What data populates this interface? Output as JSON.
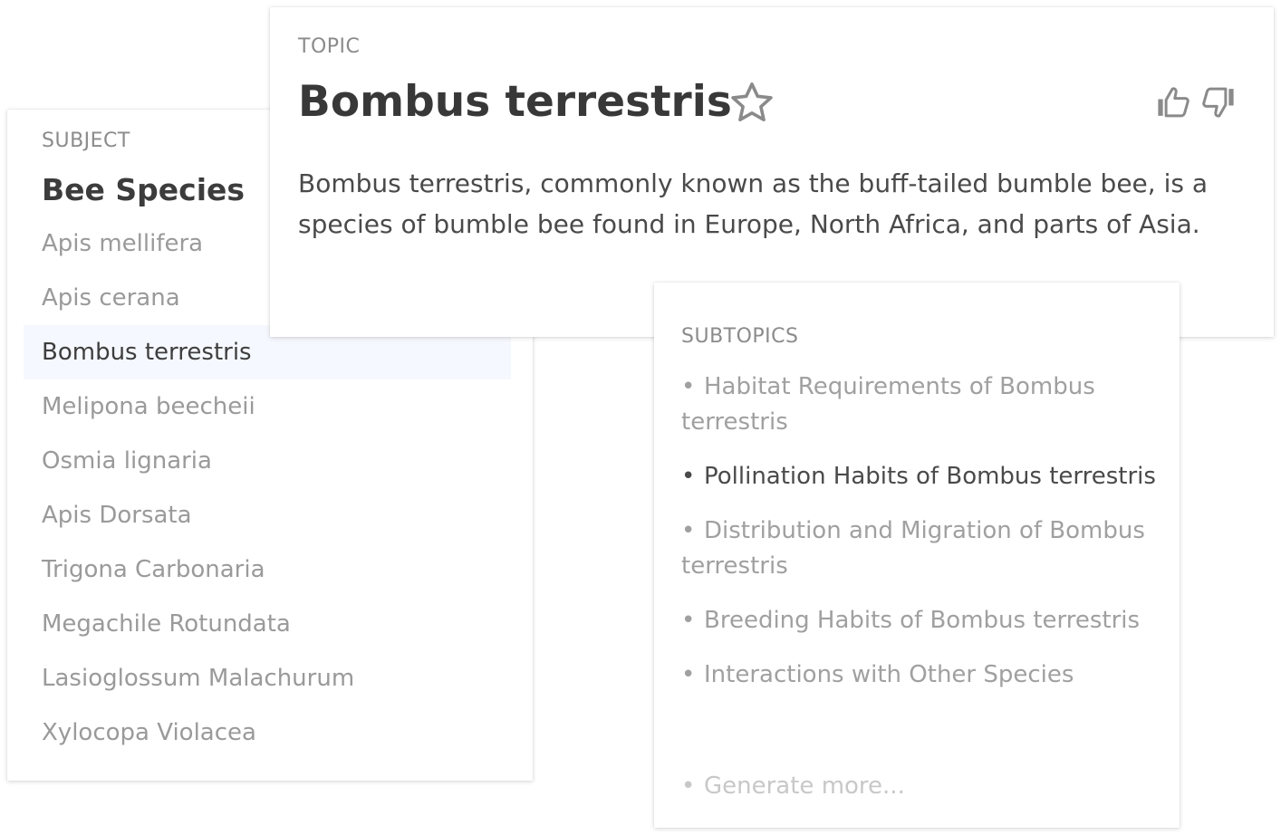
{
  "subject": {
    "overline": "SUBJECT",
    "title": "Bee Species",
    "items": [
      {
        "label": "Apis mellifera",
        "active": false
      },
      {
        "label": "Apis cerana",
        "active": false
      },
      {
        "label": "Bombus terrestris",
        "active": true
      },
      {
        "label": "Melipona beecheii",
        "active": false
      },
      {
        "label": "Osmia lignaria",
        "active": false
      },
      {
        "label": "Apis Dorsata",
        "active": false
      },
      {
        "label": "Trigona Carbonaria",
        "active": false
      },
      {
        "label": "Megachile Rotundata",
        "active": false
      },
      {
        "label": "Lasioglossum Malachurum",
        "active": false
      },
      {
        "label": "Xylocopa Violacea",
        "active": false
      }
    ]
  },
  "topic": {
    "overline": "TOPIC",
    "title": "Bombus terrestris",
    "description": "Bombus terrestris, commonly known as the buff-tailed bumble bee, is a species of bumble bee found in Europe, North Africa, and parts of Asia.",
    "icons": {
      "favorite": "star-icon",
      "upvote": "thumbs-up-icon",
      "downvote": "thumbs-down-icon"
    }
  },
  "subtopics": {
    "overline": "SUBTOPICS",
    "bullet": "•",
    "items": [
      {
        "label": "Habitat Requirements of Bombus terrestris",
        "active": false
      },
      {
        "label": "Pollination Habits of Bombus terrestris",
        "active": true
      },
      {
        "label": "Distribution and Migration of Bombus terrestris",
        "active": false
      },
      {
        "label": "Breeding Habits of Bombus terrestris",
        "active": false
      },
      {
        "label": "Interactions with Other Species",
        "active": false
      }
    ],
    "generate_more": "Generate more..."
  },
  "colors": {
    "active_row_bg": "#f5f8fe",
    "muted_text": "#9a9a9a",
    "dark_text": "#383838",
    "icon_gray": "#8a8a8a"
  }
}
